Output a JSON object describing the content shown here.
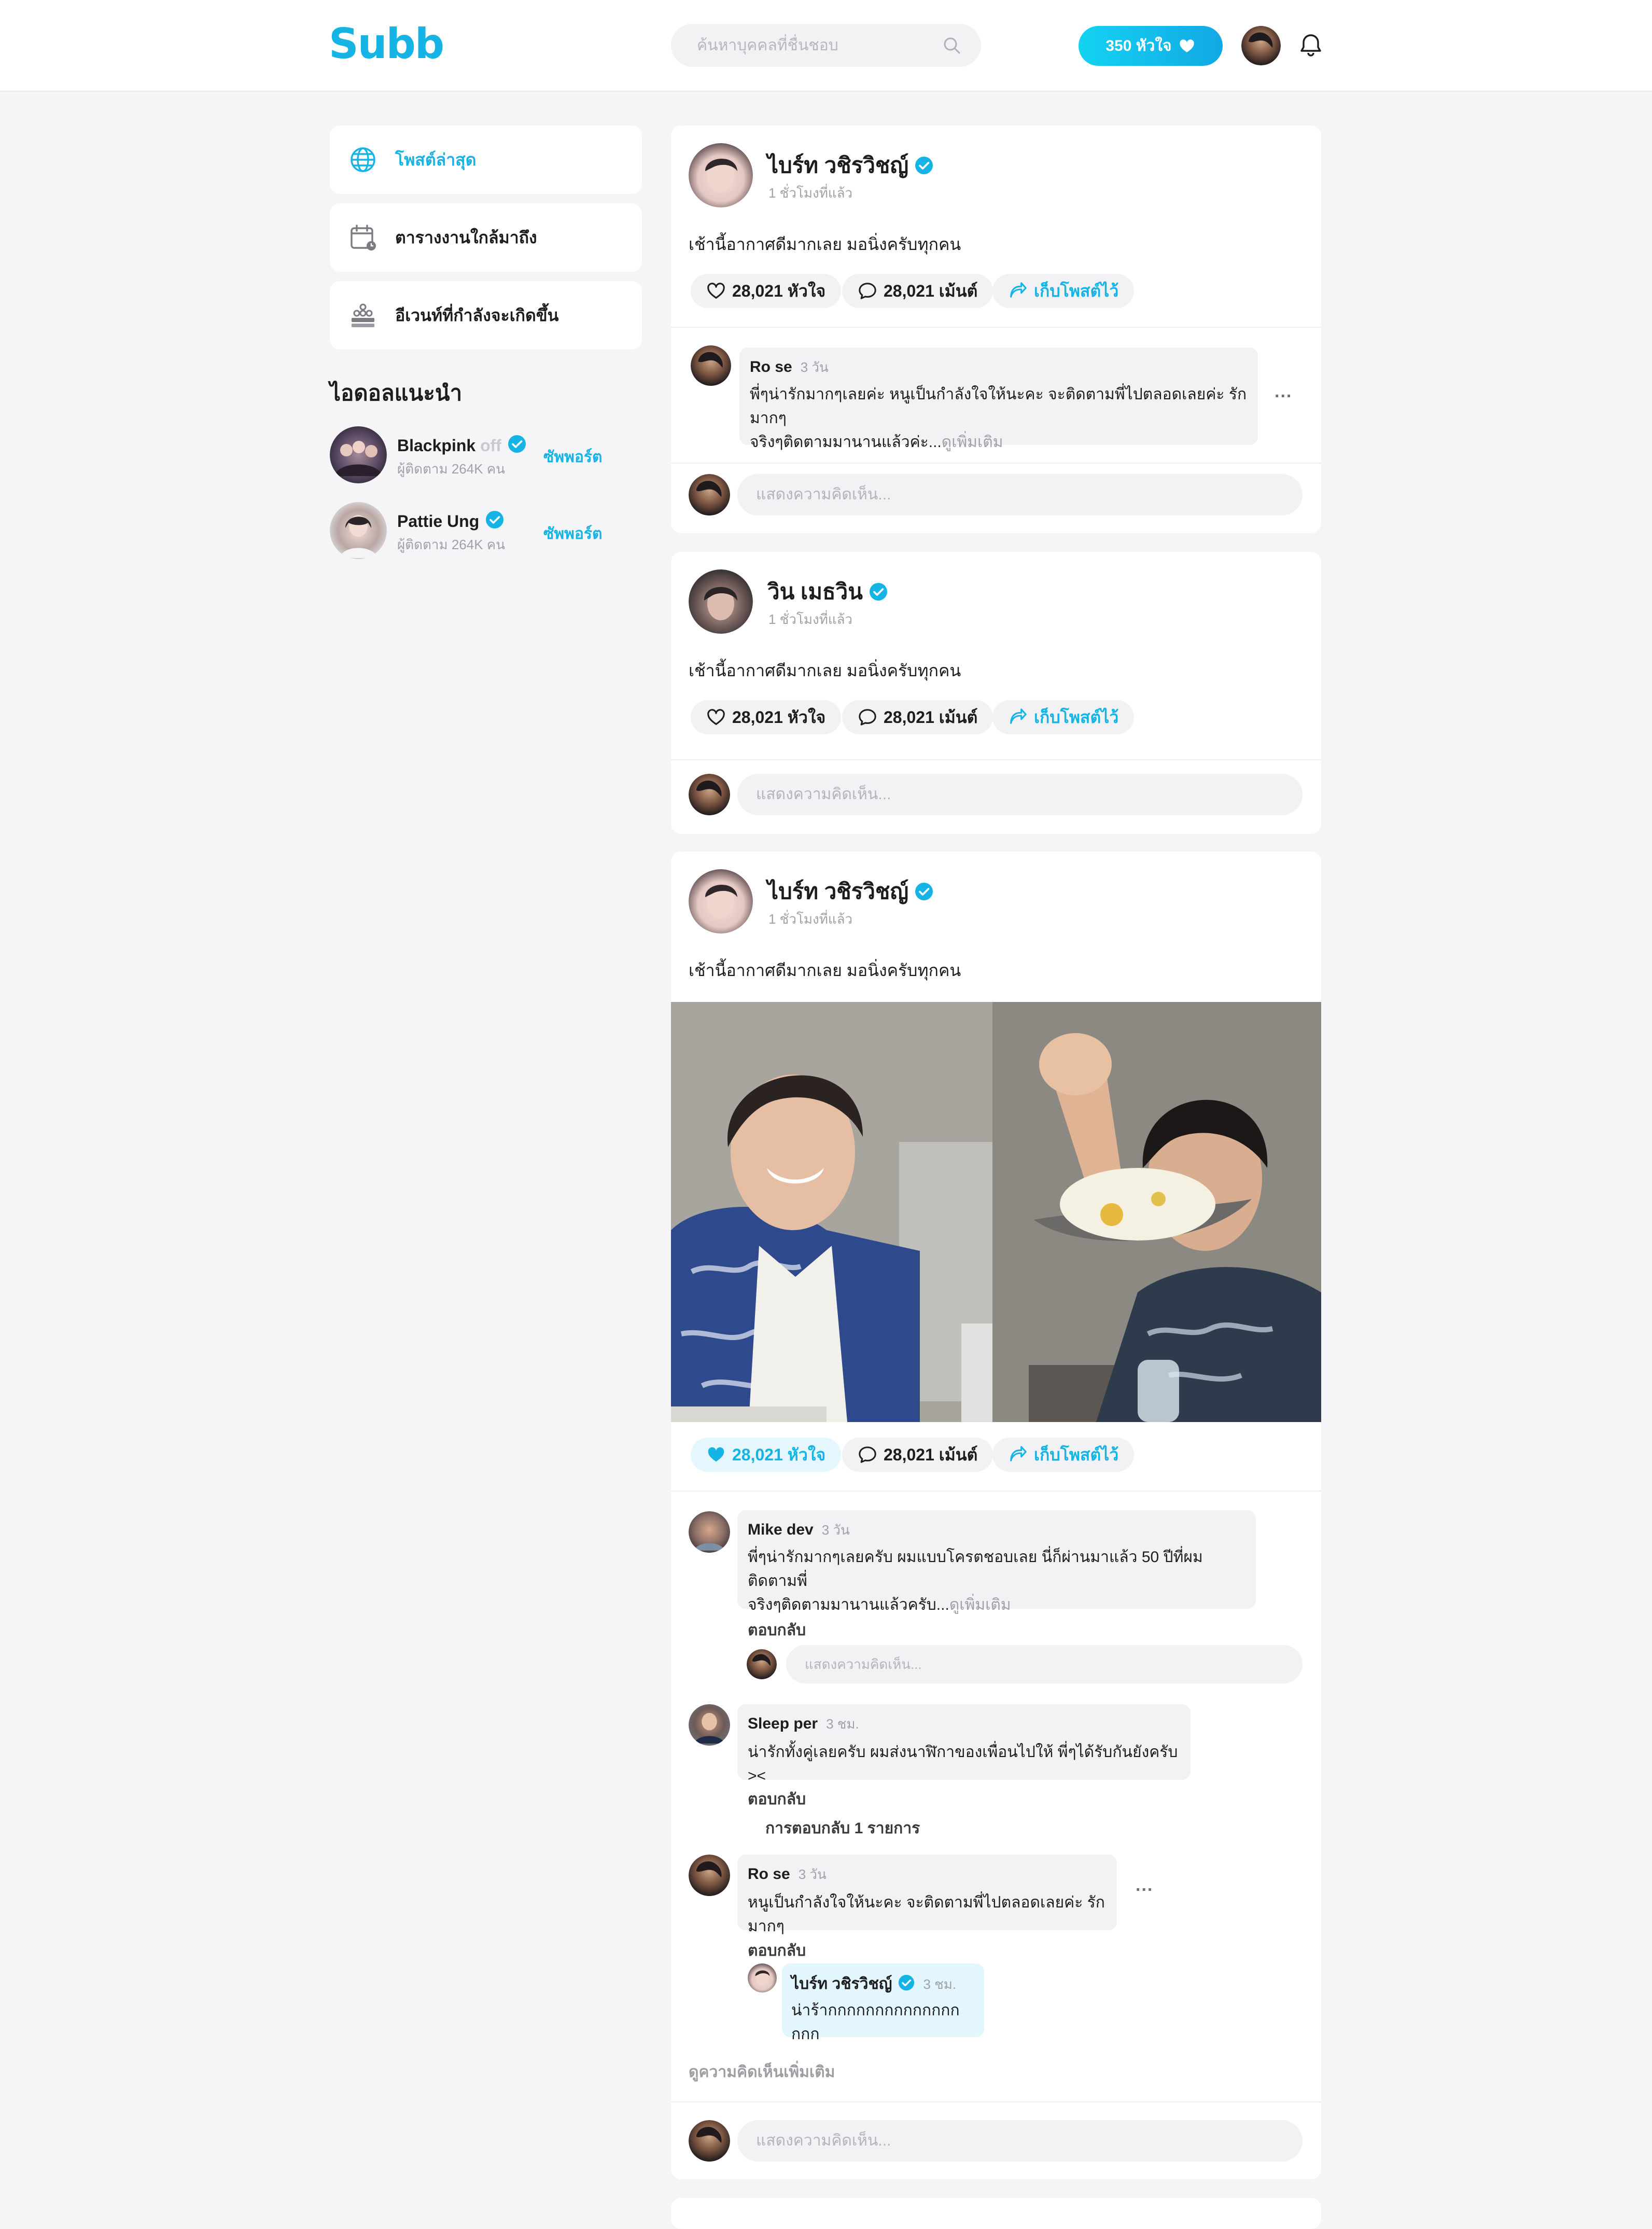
{
  "app": {
    "logo": "Subb"
  },
  "header": {
    "search_placeholder": "ค้นหาบุคคลที่ชื่นชอบ",
    "hearts_label": "350 หัวใจ",
    "icons": [
      "search-icon",
      "heart-icon",
      "bell-icon"
    ]
  },
  "sidebar": {
    "nav": [
      {
        "label": "โพสต์ล่าสุด",
        "icon": "globe-icon",
        "active": true
      },
      {
        "label": "ตารางงานใกล้มาถึง",
        "icon": "calendar-icon",
        "active": false
      },
      {
        "label": "อีเวนท์ที่กำลังจะเกิดขึ้น",
        "icon": "event-icon",
        "active": false
      }
    ],
    "recommend_title": "ไอดอลแนะนำ",
    "idols": [
      {
        "name": "Blackpink",
        "name_faded": "off",
        "followers": "ผู้ติดตาม 264K คน",
        "action": "ซัพพอร์ต"
      },
      {
        "name": "Pattie Ung",
        "name_faded": "",
        "followers": "ผู้ติดตาม 264K คน",
        "action": "ซัพพอร์ต"
      }
    ]
  },
  "feed": [
    {
      "author": "ไบร์ท วชิรวิชญ์",
      "time": "1 ชั่วโมงที่แล้ว",
      "text": "เช้านี้อากาศดีมากเลย มอนิ่งครับทุกคน",
      "likes": "28,021 หัวใจ",
      "comments": "28,021 เม้นต์",
      "save": "เก็บโพสต์ไว้",
      "comment": {
        "name": "Ro se",
        "time": "3 วัน",
        "text1": "พี่ๆน่ารักมากๆเลยค่ะ หนูเป็นกำลังใจให้นะคะ จะติดตามพี่ไปตลอดเลยค่ะ รักมากๆ",
        "text2": "จริงๆติดตามมานานแล้วค่ะ...",
        "more": "ดูเพิ่มเติม"
      },
      "input_placeholder": "แสดงความคิดเห็น..."
    },
    {
      "author": "วิน เมธวิน",
      "time": "1 ชั่วโมงที่แล้ว",
      "text": "เช้านี้อากาศดีมากเลย มอนิ่งครับทุกคน",
      "likes": "28,021 หัวใจ",
      "comments": "28,021 เม้นต์",
      "save": "เก็บโพสต์ไว้",
      "input_placeholder": "แสดงความคิดเห็น..."
    },
    {
      "author": "ไบร์ท วชิรวิชญ์",
      "time": "1 ชั่วโมงที่แล้ว",
      "text": "เช้านี้อากาศดีมากเลย มอนิ่งครับทุกคน",
      "likes": "28,021 หัวใจ",
      "comments": "28,021 เม้นต์",
      "save": "เก็บโพสต์ไว้",
      "comments_list": [
        {
          "name": "Mike dev",
          "time": "3 วัน",
          "text1": "พี่ๆน่ารักมากๆเลยครับ ผมแบบโครตชอบเลย นี่ก็ผ่านมาแล้ว 50 ปีที่ผมติดตามพี่",
          "text2": "จริงๆติดตามมานานแล้วครับ...",
          "more": "ดูเพิ่มเติม",
          "reply": "ตอบกลับ",
          "reply_placeholder": "แสดงความคิดเห็น..."
        },
        {
          "name": "Sleep per",
          "time": "3 ชม.",
          "text1": "น่ารักทั้งคู่เลยครับ ผมส่งนาฬิกาของเพื่อนไปให้ พี่ๆได้รับกันยังครับ ><",
          "reply": "ตอบกลับ",
          "replies_count": "การตอบกลับ 1 รายการ"
        },
        {
          "name": "Ro se",
          "time": "3 วัน",
          "text1": "หนูเป็นกำลังใจให้นะคะ จะติดตามพี่ไปตลอดเลยค่ะ รักมากๆ",
          "reply": "ตอบกลับ",
          "nested": {
            "name": "ไบร์ท วชิรวิชญ์",
            "time": "3 ชม.",
            "text": "น่าร้ากกกกกกกกกกกกกกกกก"
          }
        }
      ],
      "see_more_comments": "ดูความคิดเห็นเพิ่มเติม",
      "input_placeholder": "แสดงความคิดเห็น..."
    }
  ],
  "colors": {
    "accent": "#16b4e5",
    "bg": "#f5f5f7",
    "card": "#ffffff"
  }
}
